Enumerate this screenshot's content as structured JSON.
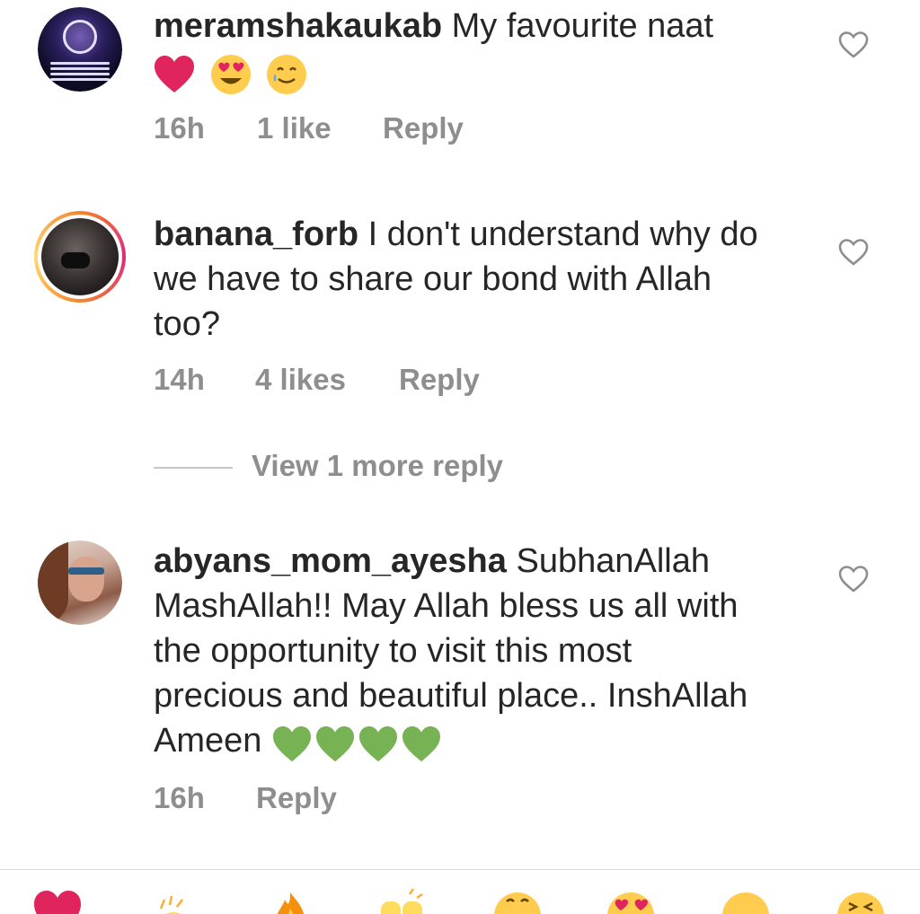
{
  "comments": [
    {
      "username": "meramshakaukab",
      "text": "My favourite naat",
      "emojis": [
        "red-heart",
        "heart-eyes-face",
        "smiling-face-with-tear"
      ],
      "time": "16h",
      "likes": "1 like",
      "reply_label": "Reply"
    },
    {
      "username": "banana_forb",
      "text": "I don't understand why do we have to share our bond with Allah too?",
      "time": "14h",
      "likes": "4 likes",
      "reply_label": "Reply"
    },
    {
      "username": "abyans_mom_ayesha",
      "text": "SubhanAllah MashAllah!! May Allah bless us all with the opportunity to visit this most precious and beautiful place.. InshAllah Ameen",
      "emojis": [
        "green-heart",
        "green-heart",
        "green-heart",
        "green-heart"
      ],
      "time": "16h",
      "reply_label": "Reply"
    }
  ],
  "view_more_replies": "View 1 more reply",
  "reaction_bar": [
    "red-heart",
    "clapping-hands",
    "fire",
    "raising-hands",
    "crying-face",
    "heart-eyes-face",
    "surprised-face",
    "laughing-face"
  ],
  "colors": {
    "text": "#262626",
    "meta": "#8e8e8e",
    "red_heart": "#e0245e",
    "green_heart": "#77b255"
  }
}
